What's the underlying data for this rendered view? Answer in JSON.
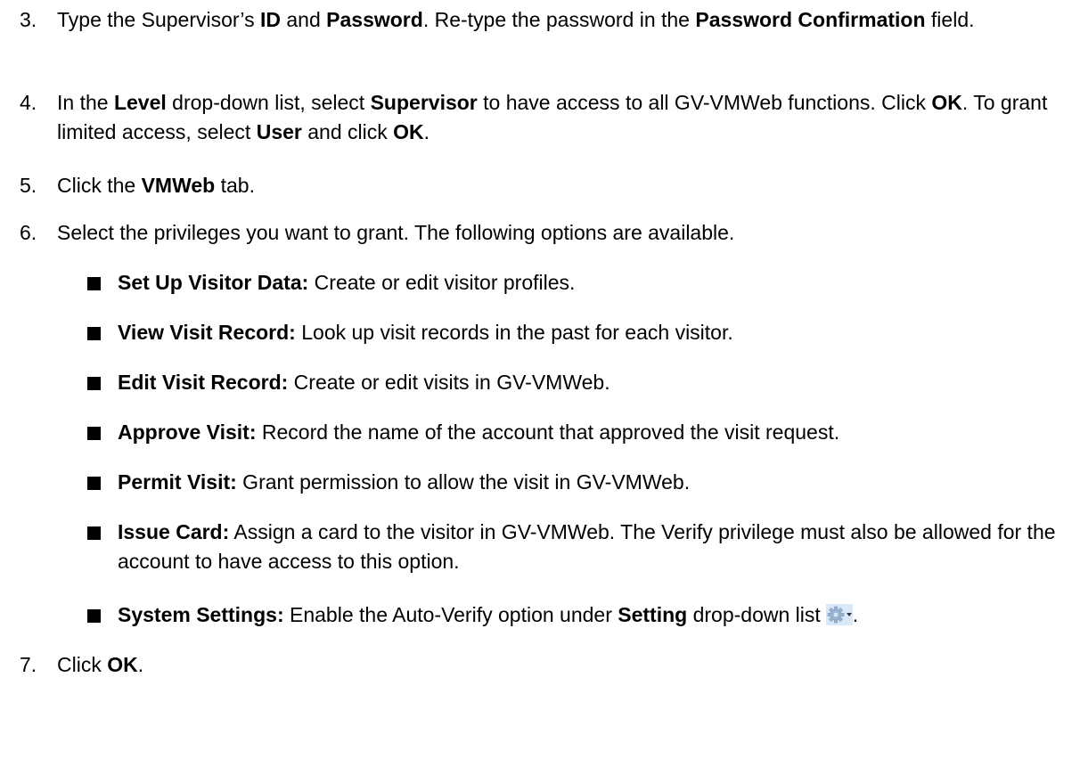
{
  "steps": [
    {
      "number": "3.",
      "t1": "Type the Supervisor’s ",
      "b1": "ID",
      "t2": " and ",
      "b2": "Password",
      "t3": ". Re-type the password in the ",
      "b3": "Password Confirmation",
      "t4": " field."
    },
    {
      "number": "4.",
      "t1": "In the ",
      "b1": "Level",
      "t2": " drop-down list, select ",
      "b2": "Supervisor",
      "t3": " to have access to all GV-VMWeb functions. Click ",
      "b3": "OK",
      "t4": ". To grant limited access, select ",
      "b4": "User",
      "t5": " and click ",
      "b5": "OK",
      "t6": "."
    },
    {
      "number": "5.",
      "t1": "Click the ",
      "b1": "VMWeb",
      "t2": " tab."
    },
    {
      "number": "6.",
      "t1": "Select the privileges you want to grant. The following options are available."
    },
    {
      "number": "7.",
      "t1": "Click ",
      "b1": "OK",
      "t2": "."
    }
  ],
  "privileges": [
    {
      "title": "Set Up Visitor Data:",
      "desc": " Create or edit visitor profiles."
    },
    {
      "title": "View Visit Record:",
      "desc": " Look up visit records in the past for each visitor."
    },
    {
      "title": "Edit Visit Record:",
      "desc": " Create or edit visits in GV-VMWeb."
    },
    {
      "title": "Approve Visit:",
      "desc": " Record the name of the account that approved the visit request."
    },
    {
      "title": "Permit Visit:",
      "desc": " Grant permission to allow the visit in GV-VMWeb."
    },
    {
      "title": "Issue Card:",
      "desc": " Assign a card to the visitor in GV-VMWeb. The Verify privilege must also be allowed for the account to have access to this option."
    },
    {
      "title": "System Settings:",
      "desc": " Enable the Auto-Verify option under ",
      "bold2": "Setting",
      "desc2": " drop-down list",
      "end": "."
    }
  ],
  "icons": {
    "settings_icon": "gear-dropdown-icon",
    "gear_color": "#9ab4d0",
    "gear_bg": "#d9e9f8"
  }
}
